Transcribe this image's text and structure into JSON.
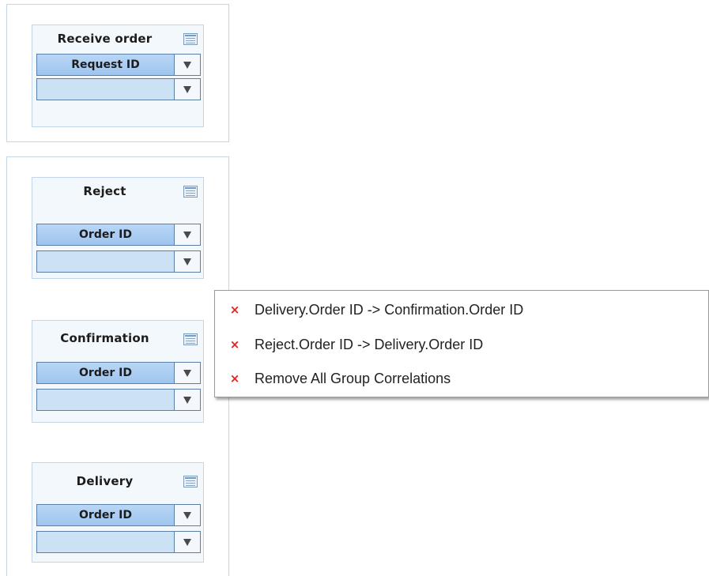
{
  "groups": [
    {
      "cards": [
        {
          "title": "Receive order",
          "primary_value": "Request ID",
          "secondary_value": ""
        }
      ]
    },
    {
      "cards": [
        {
          "title": "Reject",
          "primary_value": "Order ID",
          "secondary_value": ""
        },
        {
          "title": "Confirmation",
          "primary_value": "Order ID",
          "secondary_value": ""
        },
        {
          "title": "Delivery",
          "primary_value": "Order ID",
          "secondary_value": ""
        }
      ]
    }
  ],
  "context_menu": {
    "items": [
      {
        "label": "Delivery.Order ID -> Confirmation.Order ID",
        "icon": "remove-x-icon"
      },
      {
        "label": "Reject.Order ID -> Delivery.Order ID",
        "icon": "remove-x-icon"
      },
      {
        "label": "Remove All Group Correlations",
        "icon": "remove-x-icon"
      }
    ],
    "remove_glyph": "×"
  },
  "colors": {
    "remove_icon": "#e1231c",
    "card_border": "#c3d5e8",
    "combo_fill": "#a9cdf2"
  }
}
